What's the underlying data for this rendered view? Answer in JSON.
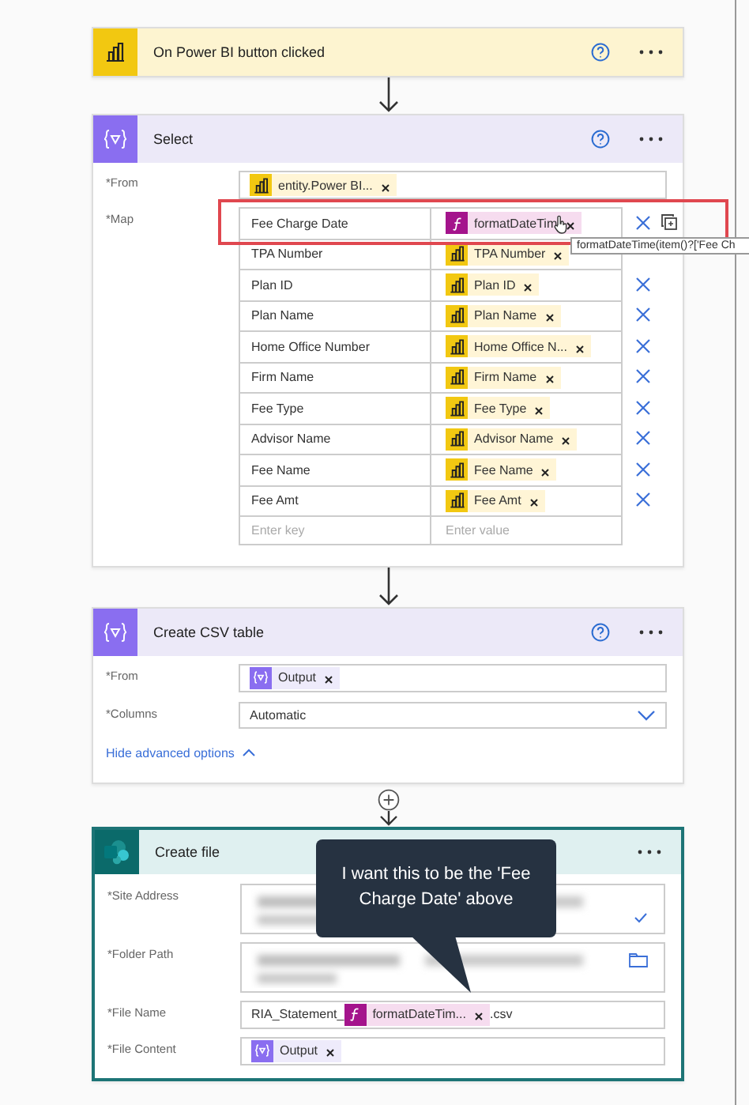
{
  "trigger": {
    "title": "On Power BI button clicked"
  },
  "select": {
    "title": "Select",
    "from": {
      "label": "*From",
      "parts": [
        {
          "kind": "powerbi",
          "text": "entity.Power BI..."
        }
      ]
    },
    "map": {
      "label": "*Map",
      "key_placeholder": "Enter key",
      "value_placeholder": "Enter value",
      "rows": [
        {
          "key": "Fee Charge Date",
          "value": {
            "kind": "expression",
            "text": "formatDateTim"
          },
          "kind": "active"
        },
        {
          "key": "TPA Number",
          "value": {
            "kind": "powerbi",
            "text": "TPA Number"
          },
          "kind": "plain"
        },
        {
          "key": "Plan ID",
          "value": {
            "kind": "powerbi",
            "text": "Plan ID"
          },
          "kind": "removable"
        },
        {
          "key": "Plan Name",
          "value": {
            "kind": "powerbi",
            "text": "Plan Name"
          },
          "kind": "removable"
        },
        {
          "key": "Home Office Number",
          "value": {
            "kind": "powerbi",
            "text": "Home Office N..."
          },
          "kind": "removable"
        },
        {
          "key": "Firm Name",
          "value": {
            "kind": "powerbi",
            "text": "Firm Name"
          },
          "kind": "removable"
        },
        {
          "key": "Fee Type",
          "value": {
            "kind": "powerbi",
            "text": "Fee Type"
          },
          "kind": "removable"
        },
        {
          "key": "Advisor Name",
          "value": {
            "kind": "powerbi",
            "text": "Advisor Name"
          },
          "kind": "removable"
        },
        {
          "key": "Fee Name",
          "value": {
            "kind": "powerbi",
            "text": "Fee Name"
          },
          "kind": "removable"
        },
        {
          "key": "Fee Amt",
          "value": {
            "kind": "powerbi",
            "text": "Fee Amt"
          },
          "kind": "removable"
        }
      ]
    },
    "tooltip": "formatDateTime(item()?['Fee Ch"
  },
  "csv_table": {
    "title": "Create CSV table",
    "from": {
      "label": "*From",
      "parts": [
        {
          "kind": "variable",
          "text": "Output"
        }
      ]
    },
    "columns": {
      "label": "*Columns",
      "value": "Automatic"
    },
    "advanced_link": "Hide advanced options"
  },
  "create_file": {
    "title": "Create file",
    "fields": [
      {
        "label": "*Site Address",
        "kind": "site_picker"
      },
      {
        "label": "*Folder Path",
        "kind": "folder_picker"
      },
      {
        "label": "*File Name",
        "kind": "parts",
        "parts": [
          {
            "kind": "text",
            "text": "RIA_Statement_"
          },
          {
            "kind": "expression",
            "text": "formatDateTim..."
          },
          {
            "kind": "text",
            "text": ".csv"
          }
        ]
      },
      {
        "label": "*File Content",
        "kind": "parts",
        "parts": [
          {
            "kind": "variable",
            "text": "Output"
          }
        ]
      }
    ],
    "callout": "I want this to be the 'Fee Charge Date' above"
  }
}
